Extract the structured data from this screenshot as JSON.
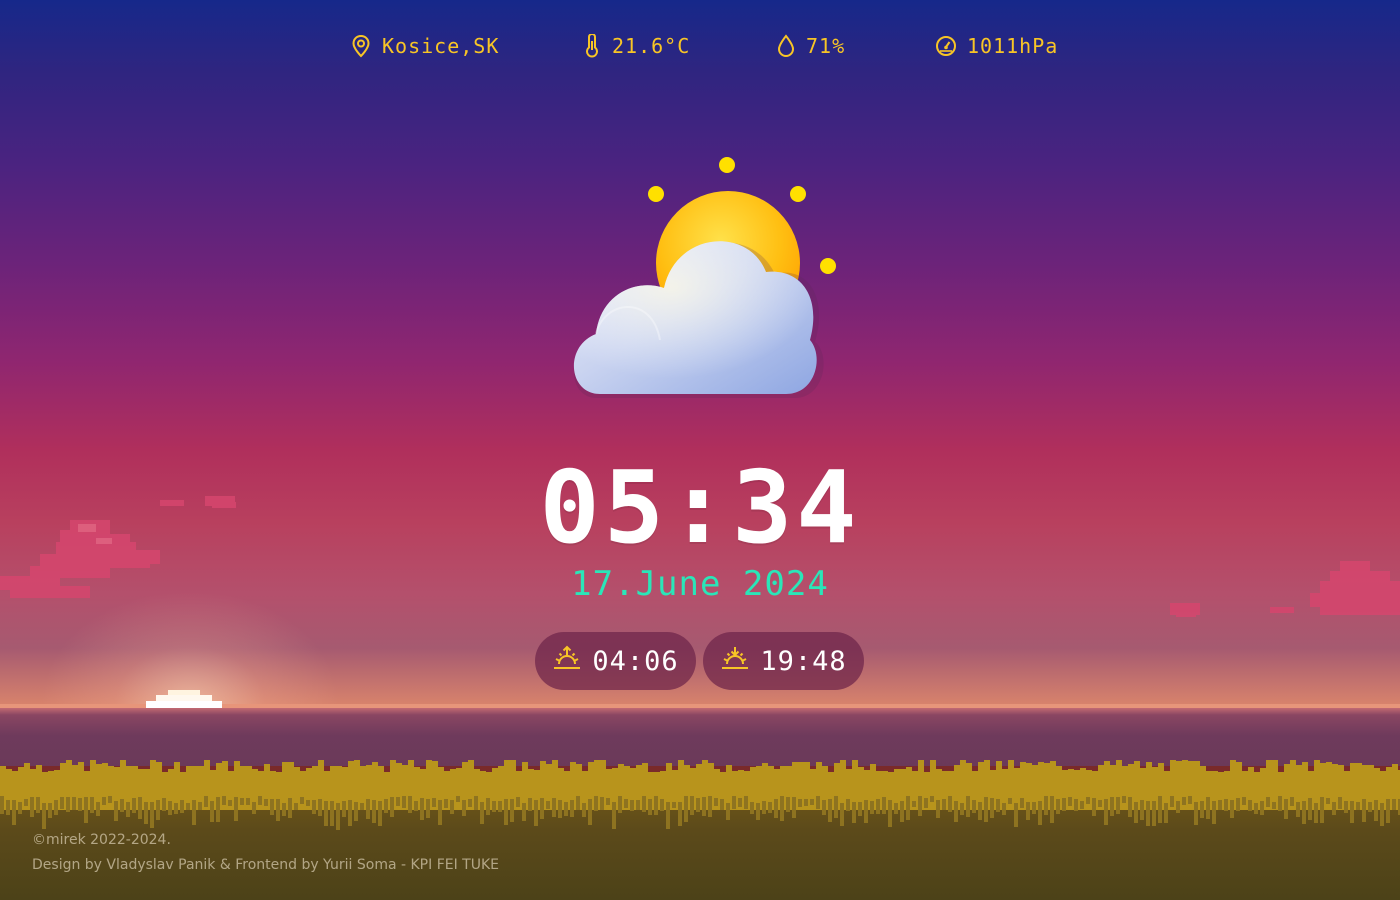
{
  "weather": {
    "location": "Kosice,SK",
    "temperature": "21.6°C",
    "humidity": "71%",
    "pressure": "1011hPa",
    "condition_icon": "partly-cloudy-icon"
  },
  "clock": {
    "time": "05:34",
    "date": "17.June 2024"
  },
  "sun": {
    "sunrise": "04:06",
    "sunset": "19:48"
  },
  "footer": {
    "copyright": "©mirek 2022-2024.",
    "credits": "Design by Vladyslav Panik & Frontend by Yurii Soma - KPI FEI TUKE"
  },
  "colors": {
    "accent_yellow": "#f8c526",
    "date_teal": "#2ae6b8",
    "sky_top": "#16288a",
    "sky_mid": "#b02f5c",
    "grass": "#b8941c"
  }
}
